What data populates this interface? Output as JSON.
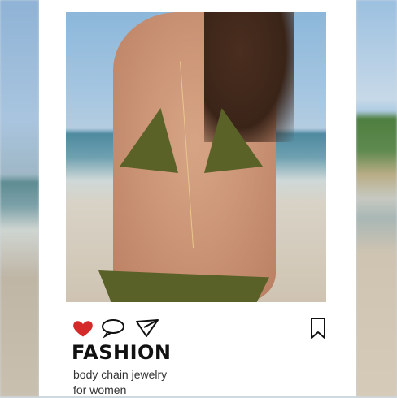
{
  "post": {
    "title": "FASHION",
    "caption_line1": "body chain jewelry",
    "caption_line2": "for women"
  },
  "icons": {
    "like": "heart-icon",
    "comment": "comment-icon",
    "share": "paper-plane-icon",
    "save": "bookmark-icon"
  },
  "colors": {
    "heart": "#d42a2a",
    "card": "#ffffff",
    "title": "#111111"
  }
}
